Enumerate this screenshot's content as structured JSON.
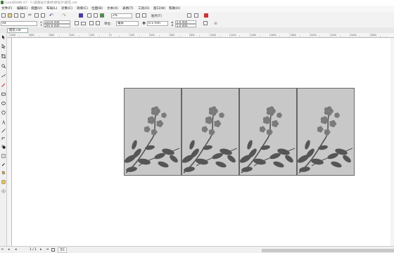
{
  "window": {
    "title": "CorelDRAW X7 - F:\\美图设计素材\\原设计\\窗花.cdr"
  },
  "menu": {
    "items": [
      "文件(F)",
      "编辑(E)",
      "视图(V)",
      "布局(L)",
      "对象(C)",
      "效果(C)",
      "位图(B)",
      "文本(X)",
      "表格(T)",
      "工具(O)",
      "窗口(W)",
      "帮助(H)"
    ]
  },
  "toolbar": {
    "zoom": "2%",
    "snap_label": "贴齐(T)"
  },
  "property_bar": {
    "page_size": "A4",
    "width": "210.0 mm",
    "height": "297.0 mm",
    "units_label": "单位:",
    "units": "毫米",
    "nudge": "0.1 mm",
    "dup_x": "5.0 mm",
    "dup_y": "5.0 mm"
  },
  "document": {
    "tab_label": "窗花.cdr"
  },
  "rulers": {
    "h_ticks": [
      "1000",
      "800",
      "600",
      "400",
      "200",
      "0",
      "200",
      "400",
      "600",
      "800",
      "1000",
      "1200",
      "1400",
      "1600",
      "1800",
      "2000",
      "2200",
      "2400",
      "2600"
    ]
  },
  "status": {
    "page_counter": "1 / 1",
    "page_tab": "页1"
  },
  "colors": {
    "panel_bg": "#c8c8c8",
    "flower": "#555555"
  }
}
